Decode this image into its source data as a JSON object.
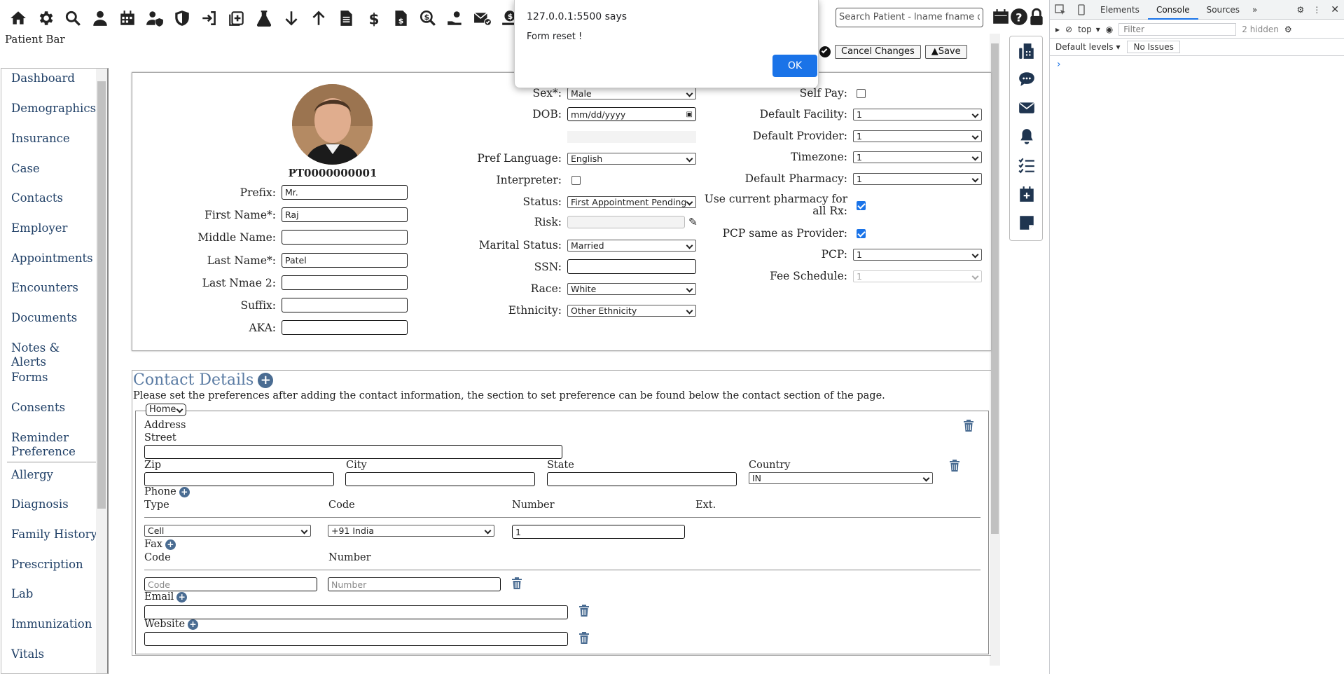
{
  "toolbar": {
    "icons": [
      "home-icon",
      "gear-icon",
      "search-icon",
      "user-icon",
      "calendar-icon",
      "user-shield-icon",
      "shield-icon",
      "sign-in-icon",
      "add-file-icon",
      "flask-icon",
      "arrow-down-icon",
      "arrow-up-icon",
      "file-text-icon",
      "dollar-icon",
      "invoice-icon",
      "search-dollar-icon",
      "hand-coin-icon",
      "mail-check-icon",
      "coin-hand-icon",
      "money-bag-icon",
      "receipt-icon"
    ],
    "patient_bar_label": "Patient Bar",
    "search_placeholder": "Search Patient - lname fname dob",
    "right_icons": [
      "calendar-grid-icon",
      "help-icon",
      "lock-icon"
    ]
  },
  "sidebar": {
    "items": [
      {
        "label": "Dashboard"
      },
      {
        "label": "Demographics"
      },
      {
        "label": "Insurance"
      },
      {
        "label": "Case"
      },
      {
        "label": "Contacts"
      },
      {
        "label": "Employer"
      },
      {
        "label": "Appointments"
      },
      {
        "label": "Encounters"
      },
      {
        "label": "Documents"
      },
      {
        "label": "Notes & Alerts"
      },
      {
        "label": "Forms"
      },
      {
        "label": "Consents"
      },
      {
        "label": "Reminder Preference"
      },
      {
        "label": "Allergy"
      },
      {
        "label": "Diagnosis"
      },
      {
        "label": "Family History"
      },
      {
        "label": "Prescription"
      },
      {
        "label": "Lab"
      },
      {
        "label": "Immunization"
      },
      {
        "label": "Vitals"
      }
    ]
  },
  "actions": {
    "cancel_label": "Cancel Changes",
    "save_label": "Save"
  },
  "patient": {
    "id": "PT0000000001",
    "prefix_label": "Prefix:",
    "prefix": "Mr.",
    "first_label": "First Name*:",
    "first": "Raj",
    "middle_label": "Middle Name:",
    "middle": "",
    "last_label": "Last Name*:",
    "last": "Patel",
    "last2_label": "Last Nmae 2:",
    "last2": "",
    "suffix_label": "Suffix:",
    "suffix": "",
    "aka_label": "AKA:",
    "aka": ""
  },
  "middle": {
    "sex_label": "Sex*:",
    "sex": "Male",
    "dob_label": "DOB:",
    "dob": "mm/dd/yyyy",
    "lang_label": "Pref Language:",
    "lang": "English",
    "interp_label": "Interpreter:",
    "status_label": "Status:",
    "status": "First Appointment Pending",
    "risk_label": "Risk:",
    "marital_label": "Marital Status:",
    "marital": "Married",
    "ssn_label": "SSN:",
    "race_label": "Race:",
    "race": "White",
    "eth_label": "Ethnicity:",
    "eth": "Other Ethnicity"
  },
  "right": {
    "selfpay_label": "Self Pay:",
    "facility_label": "Default Facility:",
    "facility": "1",
    "provider_label": "Default Provider:",
    "provider": "1",
    "tz_label": "Timezone:",
    "tz": "1",
    "pharmacy_label": "Default Pharmacy:",
    "pharmacy": "1",
    "usepharm_label": "Use current pharmacy for all Rx:",
    "pcpsame_label": "PCP same as Provider:",
    "pcp_label": "PCP:",
    "pcp": "1",
    "fee_label": "Fee Schedule:",
    "fee": "1"
  },
  "contact": {
    "title": "Contact Details",
    "note": "Please set the preferences after adding the contact information, the section to set preference can be found below the contact section of the page.",
    "home_select": "Home",
    "address_label": "Address",
    "street_label": "Street",
    "zip_label": "Zip",
    "city_label": "City",
    "state_label": "State",
    "country_label": "Country",
    "country": "IN",
    "phone_label": "Phone",
    "type_col": "Type",
    "code_col": "Code",
    "number_col": "Number",
    "ext_col": "Ext.",
    "phone_type": "Cell",
    "phone_code": "+91 India",
    "phone_number": "1",
    "fax_label": "Fax",
    "fax_code_col": "Code",
    "fax_number_col": "Number",
    "fax_code_ph": "Code",
    "fax_number_ph": "Number",
    "email_label": "Email",
    "website_label": "Website"
  },
  "alert": {
    "title": "127.0.0.1:5500 says",
    "message": "Form reset !",
    "ok": "OK"
  },
  "devtools": {
    "tabs": [
      "Elements",
      "Console",
      "Sources"
    ],
    "context": "top",
    "filter_placeholder": "Filter",
    "hidden": "2 hidden",
    "levels": "Default levels",
    "issues": "No Issues"
  }
}
